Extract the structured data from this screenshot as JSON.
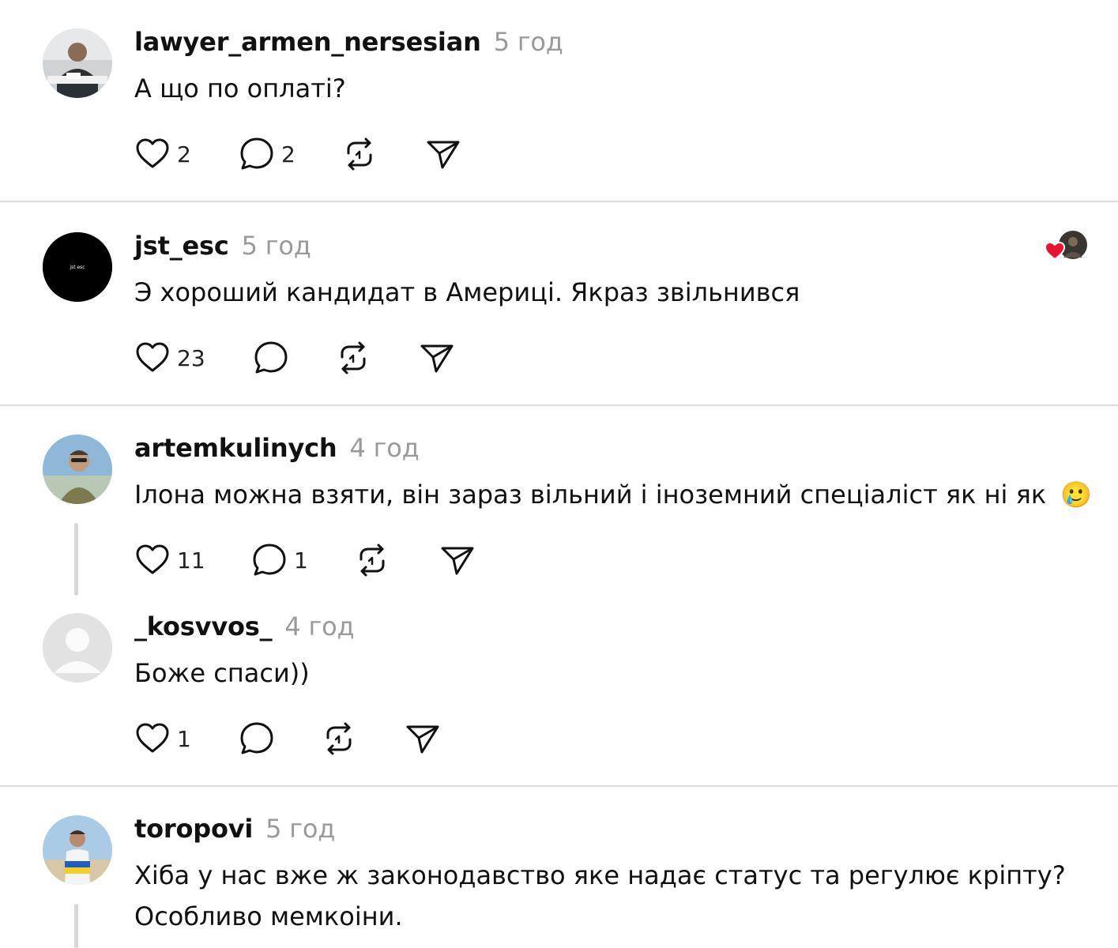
{
  "comments": [
    {
      "username": "lawyer_armen_nersesian",
      "time": "5 год",
      "text": "А що по оплаті?",
      "likes": "2",
      "replies": "2",
      "avatar": "photo-man-at-desk"
    },
    {
      "username": "jst_esc",
      "time": "5 год",
      "text": "Э хороший кандидат в Америці. Якраз звільнився",
      "likes": "23",
      "replies": "",
      "avatar": "black-logo",
      "avatar_text": "jst esc"
    },
    {
      "username": "artemkulinych",
      "time": "4 год",
      "text": "Ілона можна взяти, він зараз вільний і іноземний спеціаліст як ні як",
      "emoji": "🥲",
      "likes": "11",
      "replies": "1",
      "avatar": "photo-man-sunglasses"
    },
    {
      "username": "_kosvvos_",
      "time": "4 год",
      "text": "Боже спаси))",
      "likes": "1",
      "replies": "",
      "avatar": "default-user-icon"
    },
    {
      "username": "toropovi",
      "time": "5 год",
      "text_line1": "Хіба у нас вже ж законодавство яке надає статус та регулює кріпту?",
      "text_line2": "Особливо мемкоіни.",
      "avatar": "photo-man-ukraine-flag"
    }
  ],
  "colors": {
    "time": "#9a9a9a",
    "separator": "#dcdcdc",
    "heart_red": "#e8152f"
  }
}
